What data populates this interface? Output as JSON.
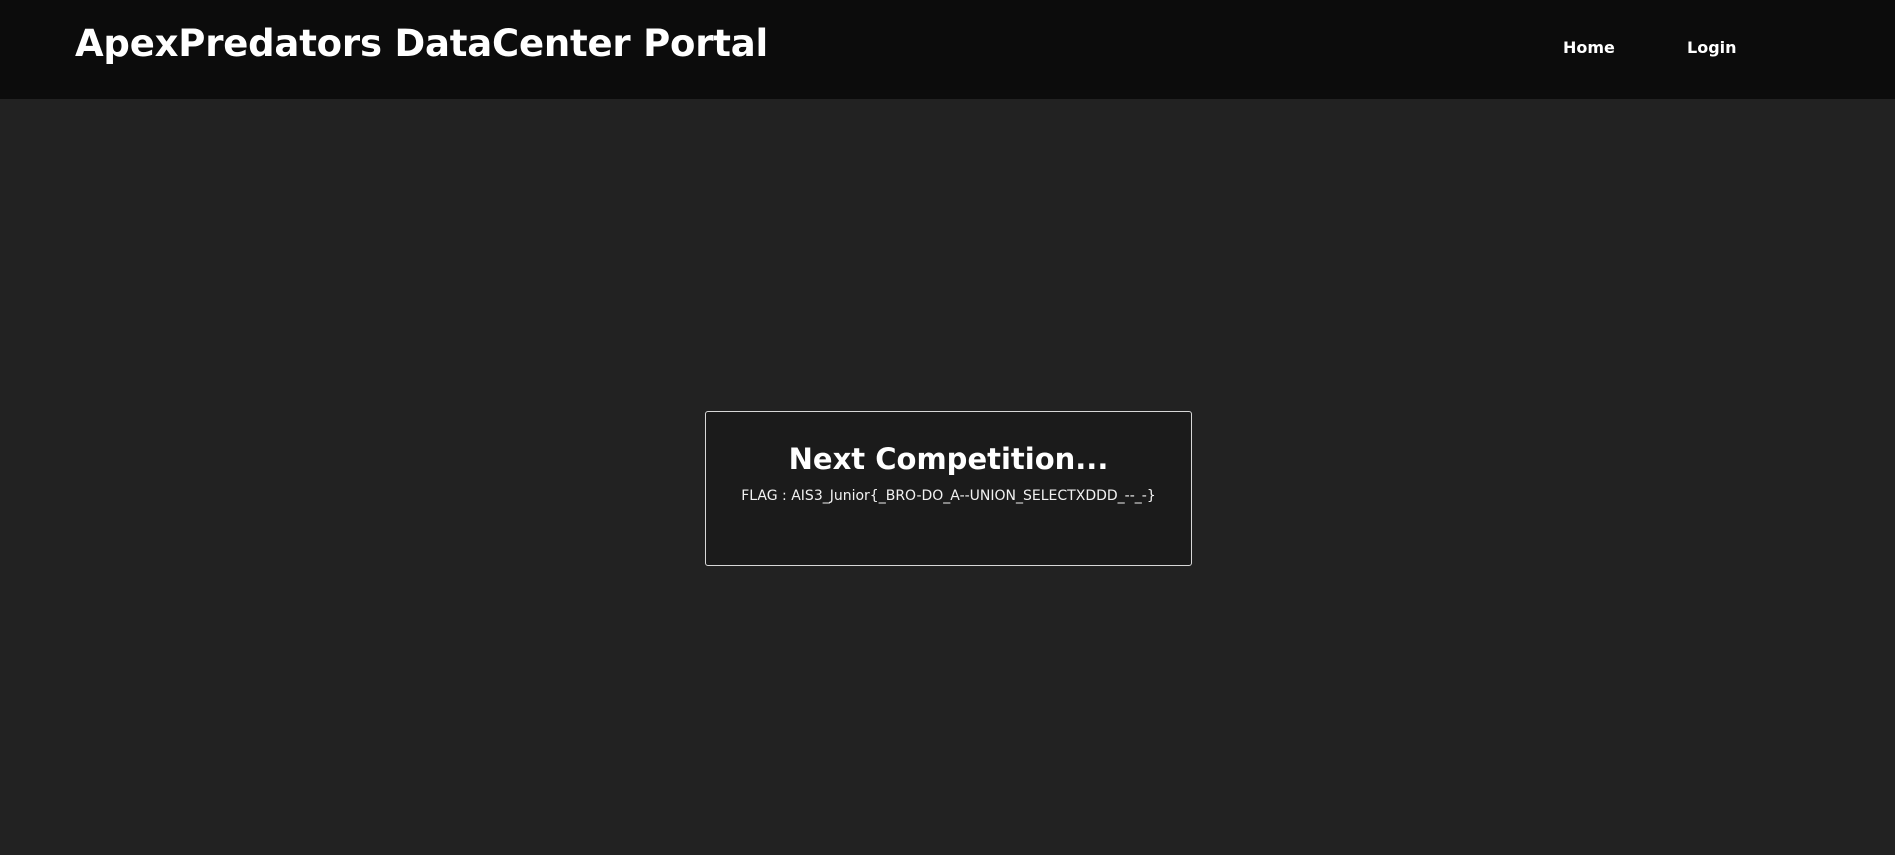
{
  "header": {
    "brand": "ApexPredators DataCenter Portal",
    "nav": {
      "home": "Home",
      "login": "Login"
    }
  },
  "card": {
    "title": "Next Competition...",
    "flag": "FLAG : AIS3_Junior{_BRO-DO_A--UNION_SELECTXDDD_--_-}"
  },
  "colors": {
    "page_background": "#222222",
    "header_background": "#0c0c0c",
    "card_background": "#1b1b1b",
    "card_border": "#d8d8d8",
    "text": "#ffffff"
  }
}
